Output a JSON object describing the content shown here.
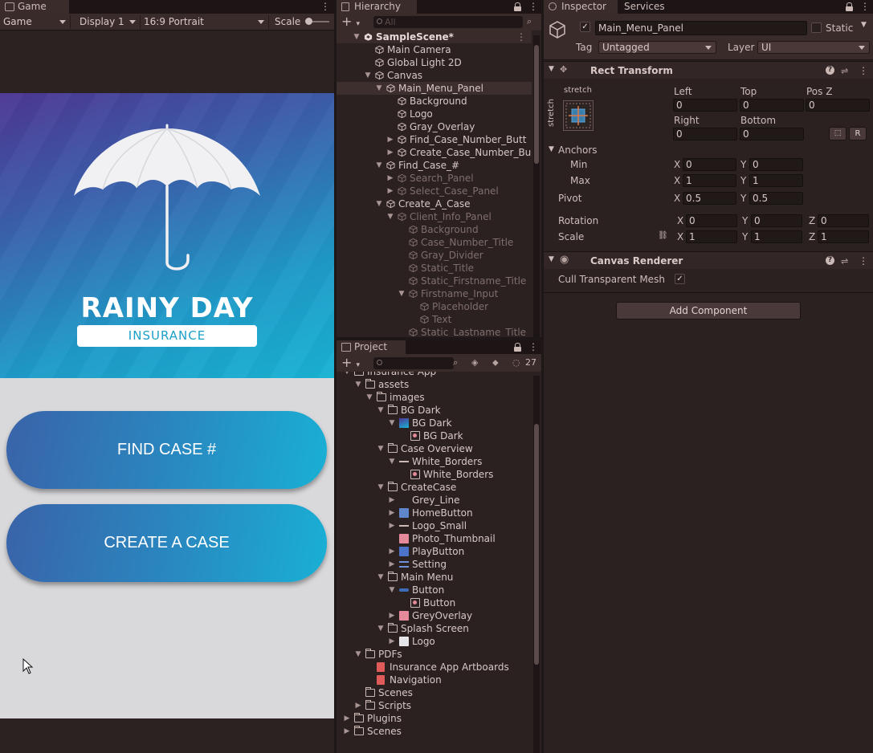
{
  "game": {
    "tab": "Game",
    "toolbar": {
      "mode": "Game",
      "display": "Display 1",
      "aspect": "16:9 Portrait",
      "scale_label": "Scale"
    },
    "app": {
      "brand_title": "RAINY DAY",
      "brand_subtitle": "INSURANCE",
      "buttons": [
        "FIND CASE #",
        "CREATE A CASE"
      ]
    }
  },
  "hierarchy": {
    "tab": "Hierarchy",
    "search_placeholder": "All",
    "rows": [
      {
        "label": "SampleScene*",
        "depth": 0,
        "expanded": true,
        "kind": "scene"
      },
      {
        "label": "Main Camera",
        "depth": 1
      },
      {
        "label": "Global Light 2D",
        "depth": 1
      },
      {
        "label": "Canvas",
        "depth": 1,
        "expanded": true
      },
      {
        "label": "Main_Menu_Panel",
        "depth": 2,
        "expanded": true,
        "selected": true
      },
      {
        "label": "Background",
        "depth": 3
      },
      {
        "label": "Logo",
        "depth": 3
      },
      {
        "label": "Gray_Overlay",
        "depth": 3
      },
      {
        "label": "Find_Case_Number_Butt",
        "depth": 3,
        "expanded": false
      },
      {
        "label": "Create_Case_Number_Bu",
        "depth": 3,
        "expanded": false
      },
      {
        "label": "Find_Case_#",
        "depth": 2,
        "expanded": true
      },
      {
        "label": "Search_Panel",
        "depth": 3,
        "expanded": false,
        "dim": true
      },
      {
        "label": "Select_Case_Panel",
        "depth": 3,
        "expanded": false,
        "dim": true
      },
      {
        "label": "Create_A_Case",
        "depth": 2,
        "expanded": true
      },
      {
        "label": "Client_Info_Panel",
        "depth": 3,
        "expanded": true,
        "dim": true
      },
      {
        "label": "Background",
        "depth": 4,
        "dim": true
      },
      {
        "label": "Case_Number_Title",
        "depth": 4,
        "dim": true
      },
      {
        "label": "Gray_Divider",
        "depth": 4,
        "dim": true
      },
      {
        "label": "Static_Title",
        "depth": 4,
        "dim": true
      },
      {
        "label": "Static_Firstname_Title",
        "depth": 4,
        "dim": true
      },
      {
        "label": "Firstname_Input",
        "depth": 4,
        "expanded": true,
        "dim": true
      },
      {
        "label": "Placeholder",
        "depth": 5,
        "dim": true
      },
      {
        "label": "Text",
        "depth": 5,
        "dim": true
      },
      {
        "label": "Static_Lastname_Title",
        "depth": 4,
        "dim": true
      }
    ]
  },
  "project": {
    "tab": "Project",
    "hidden_count": "27",
    "rows": [
      {
        "label": "Insurance App",
        "depth": 1,
        "expanded": true,
        "icon": "folder"
      },
      {
        "label": "assets",
        "depth": 2,
        "expanded": true,
        "icon": "folder"
      },
      {
        "label": "images",
        "depth": 3,
        "expanded": true,
        "icon": "folder"
      },
      {
        "label": "BG Dark",
        "depth": 4,
        "expanded": true,
        "icon": "folder"
      },
      {
        "label": "BG Dark",
        "depth": 5,
        "expanded": true,
        "icon": "texture"
      },
      {
        "label": "BG Dark",
        "depth": 6,
        "icon": "sprite"
      },
      {
        "label": "Case Overview",
        "depth": 4,
        "expanded": true,
        "icon": "folder"
      },
      {
        "label": "White_Borders",
        "depth": 5,
        "expanded": true,
        "icon": "line"
      },
      {
        "label": "White_Borders",
        "depth": 6,
        "icon": "sprite"
      },
      {
        "label": "CreateCase",
        "depth": 4,
        "expanded": true,
        "icon": "folder"
      },
      {
        "label": "Grey_Line",
        "depth": 5,
        "expanded": false,
        "icon": "none"
      },
      {
        "label": "HomeButton",
        "depth": 5,
        "expanded": false,
        "icon": "home"
      },
      {
        "label": "Logo_Small",
        "depth": 5,
        "expanded": false,
        "icon": "line"
      },
      {
        "label": "Photo_Thumbnail",
        "depth": 5,
        "icon": "photo"
      },
      {
        "label": "PlayButton",
        "depth": 5,
        "expanded": false,
        "icon": "play"
      },
      {
        "label": "Setting",
        "depth": 5,
        "expanded": false,
        "icon": "list"
      },
      {
        "label": "Main Menu",
        "depth": 4,
        "expanded": true,
        "icon": "folder"
      },
      {
        "label": "Button",
        "depth": 5,
        "expanded": true,
        "icon": "button"
      },
      {
        "label": "Button",
        "depth": 6,
        "icon": "sprite"
      },
      {
        "label": "GreyOverlay",
        "depth": 5,
        "expanded": false,
        "icon": "pink"
      },
      {
        "label": "Splash Screen",
        "depth": 4,
        "expanded": true,
        "icon": "folder"
      },
      {
        "label": "Logo",
        "depth": 5,
        "expanded": false,
        "icon": "umbrella"
      },
      {
        "label": "PDFs",
        "depth": 2,
        "expanded": true,
        "icon": "folder"
      },
      {
        "label": "Insurance App Artboards",
        "depth": 3,
        "icon": "pdf"
      },
      {
        "label": "Navigation",
        "depth": 3,
        "icon": "pdf"
      },
      {
        "label": "Scenes",
        "depth": 2,
        "icon": "folder"
      },
      {
        "label": "Scripts",
        "depth": 2,
        "expanded": false,
        "icon": "folder"
      },
      {
        "label": "Plugins",
        "depth": 1,
        "expanded": false,
        "icon": "folder"
      },
      {
        "label": "Scenes",
        "depth": 1,
        "expanded": false,
        "icon": "folder"
      }
    ]
  },
  "inspector": {
    "tab": "Inspector",
    "tab2": "Services",
    "object_name": "Main_Menu_Panel",
    "static_label": "Static",
    "tag_label": "Tag",
    "tag_value": "Untagged",
    "layer_label": "Layer",
    "layer_value": "UI",
    "rect_transform": {
      "title": "Rect Transform",
      "anchor_h": "stretch",
      "anchor_v": "stretch",
      "left_label": "Left",
      "left": "0",
      "top_label": "Top",
      "top": "0",
      "posz_label": "Pos Z",
      "posz": "0",
      "right_label": "Right",
      "right": "0",
      "bottom_label": "Bottom",
      "bottom": "0",
      "r_button": "R",
      "anchors_label": "Anchors",
      "min_label": "Min",
      "min_x": "0",
      "min_y": "0",
      "max_label": "Max",
      "max_x": "1",
      "max_y": "1",
      "pivot_label": "Pivot",
      "pivot_x": "0.5",
      "pivot_y": "0.5",
      "rotation_label": "Rotation",
      "rot_x": "0",
      "rot_y": "0",
      "rot_z": "0",
      "scale_label": "Scale",
      "scale_x": "1",
      "scale_y": "1",
      "scale_z": "1",
      "x": "X",
      "y": "Y",
      "z": "Z"
    },
    "canvas_renderer": {
      "title": "Canvas Renderer",
      "cull_label": "Cull Transparent Mesh",
      "cull_checked": true
    },
    "add_component": "Add Component"
  },
  "colors": {
    "accent": "#19b3d4",
    "hero_start": "#4d3794",
    "panel_bg": "#2c2121",
    "selection": "#3e2f2f"
  }
}
